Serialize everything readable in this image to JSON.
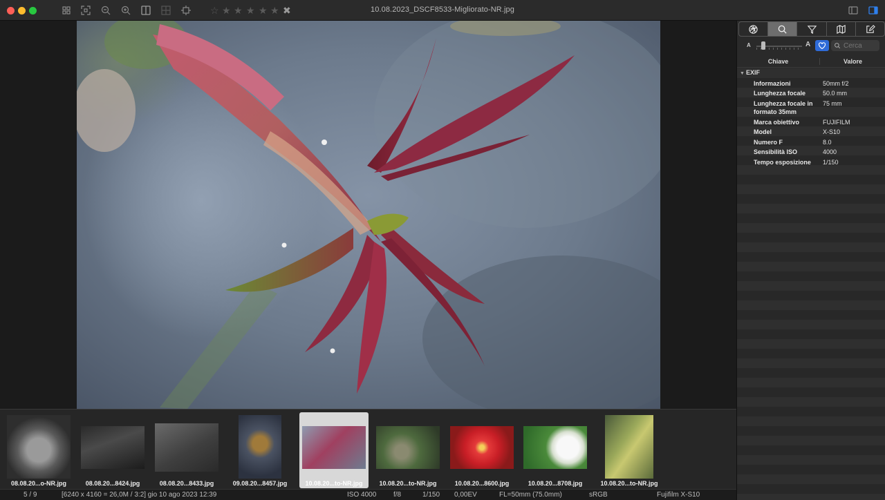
{
  "window": {
    "title": "10.08.2023_DSCF8533-Migliorato-NR.jpg"
  },
  "toolbar": {
    "icons": [
      "grid-icon",
      "fullscreen-icon",
      "zoom-out-icon",
      "zoom-in-icon",
      "split-view-icon",
      "compare-icon",
      "crop-icon"
    ],
    "rating": 0,
    "stars": [
      "☆",
      "★",
      "★",
      "★",
      "★",
      "★"
    ],
    "reject": "✖"
  },
  "panel": {
    "tabs": [
      "aperture-icon",
      "search-icon",
      "filter-icon",
      "map-icon",
      "edit-icon"
    ],
    "active_tab": 1,
    "zoom_small": "A",
    "zoom_big": "A",
    "search_placeholder": "Cerca",
    "col_key": "Chiave",
    "col_value": "Valore",
    "group": "EXIF",
    "exif": [
      {
        "k": "Informazioni",
        "v": "50mm f/2"
      },
      {
        "k": "Lunghezza focale",
        "v": "50.0 mm"
      },
      {
        "k": "Lunghezza focale in formato 35mm",
        "v": "75 mm"
      },
      {
        "k": "Marca obiettivo",
        "v": "FUJIFILM"
      },
      {
        "k": "Model",
        "v": "X-S10"
      },
      {
        "k": "Numero F",
        "v": "8.0"
      },
      {
        "k": "Sensibilità ISO",
        "v": "4000"
      },
      {
        "k": "Tempo esposizione",
        "v": "1/150"
      }
    ]
  },
  "filmstrip": {
    "selected": 4,
    "items": [
      {
        "caption": "08.08.20...o-NR.jpg",
        "theme": "bear"
      },
      {
        "caption": "08.08.20...8424.jpg",
        "theme": "scissors"
      },
      {
        "caption": "08.08.20...8433.jpg",
        "theme": "pencil"
      },
      {
        "caption": "09.08.20...8457.jpg",
        "theme": "tap"
      },
      {
        "caption": "10.08.20...to-NR.jpg",
        "theme": "leaf"
      },
      {
        "caption": "10.08.20...to-NR.jpg",
        "theme": "moss"
      },
      {
        "caption": "10.08.20...8600.jpg",
        "theme": "redflower"
      },
      {
        "caption": "10.08.20...8708.jpg",
        "theme": "whiteflower"
      },
      {
        "caption": "10.08.20...to-NR.jpg",
        "theme": "stem"
      }
    ]
  },
  "status": {
    "position": "5 / 9",
    "info": "[6240 x 4160 = 26,0M / 3:2] gio 10 ago 2023  12:39",
    "iso": "ISO 4000",
    "aperture": "f/8",
    "shutter": "1/150",
    "ev": "0,00EV",
    "focal": "FL=50mm (75.0mm)",
    "colorspace": "sRGB",
    "camera": "Fujifilm X-S10"
  }
}
